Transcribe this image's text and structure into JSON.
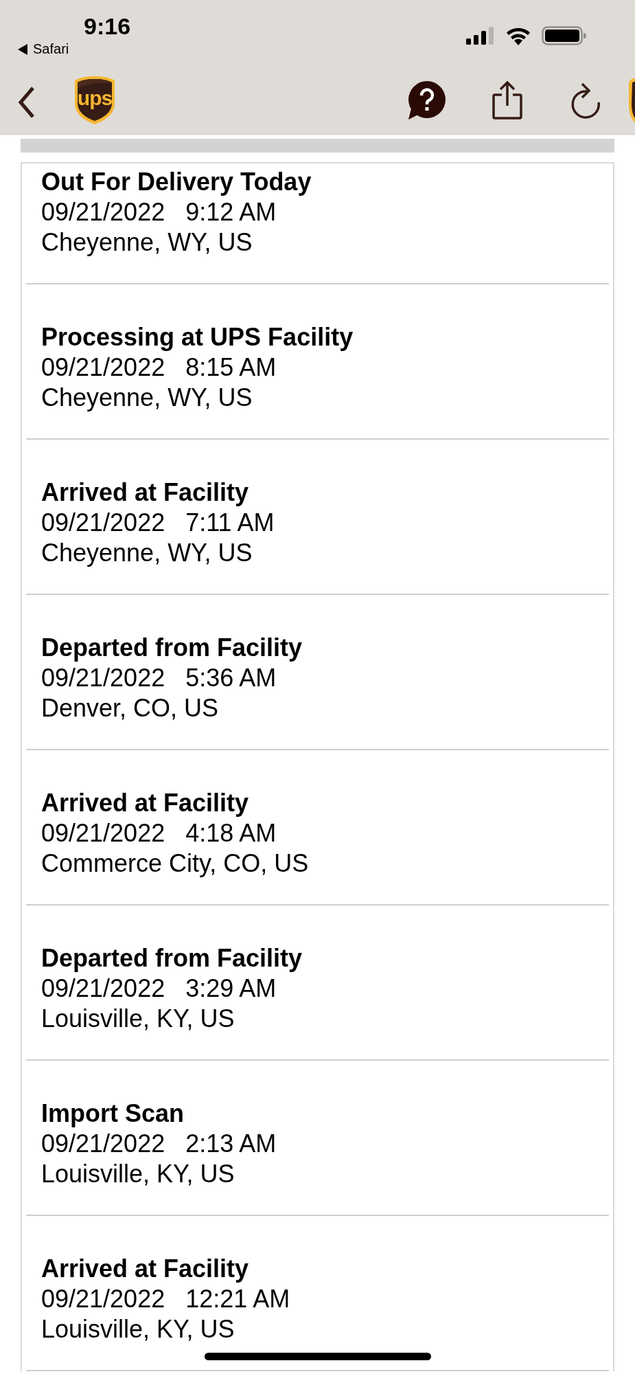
{
  "status_bar": {
    "time": "9:16",
    "back_app": "Safari"
  },
  "nav": {
    "logo_text": "ups"
  },
  "events": [
    {
      "title": "Out For Delivery Today",
      "date": "09/21/2022",
      "time": "9:12 AM",
      "location": "Cheyenne, WY, US"
    },
    {
      "title": "Processing at UPS Facility",
      "date": "09/21/2022",
      "time": "8:15 AM",
      "location": "Cheyenne, WY, US"
    },
    {
      "title": "Arrived at Facility",
      "date": "09/21/2022",
      "time": "7:11 AM",
      "location": "Cheyenne, WY, US"
    },
    {
      "title": "Departed from Facility",
      "date": "09/21/2022",
      "time": "5:36 AM",
      "location": "Denver, CO, US"
    },
    {
      "title": "Arrived at Facility",
      "date": "09/21/2022",
      "time": "4:18 AM",
      "location": "Commerce City, CO, US"
    },
    {
      "title": "Departed from Facility",
      "date": "09/21/2022",
      "time": "3:29 AM",
      "location": "Louisville, KY, US"
    },
    {
      "title": "Import Scan",
      "date": "09/21/2022",
      "time": "2:13 AM",
      "location": "Louisville, KY, US"
    },
    {
      "title": "Arrived at Facility",
      "date": "09/21/2022",
      "time": "12:21 AM",
      "location": "Louisville, KY, US"
    }
  ]
}
